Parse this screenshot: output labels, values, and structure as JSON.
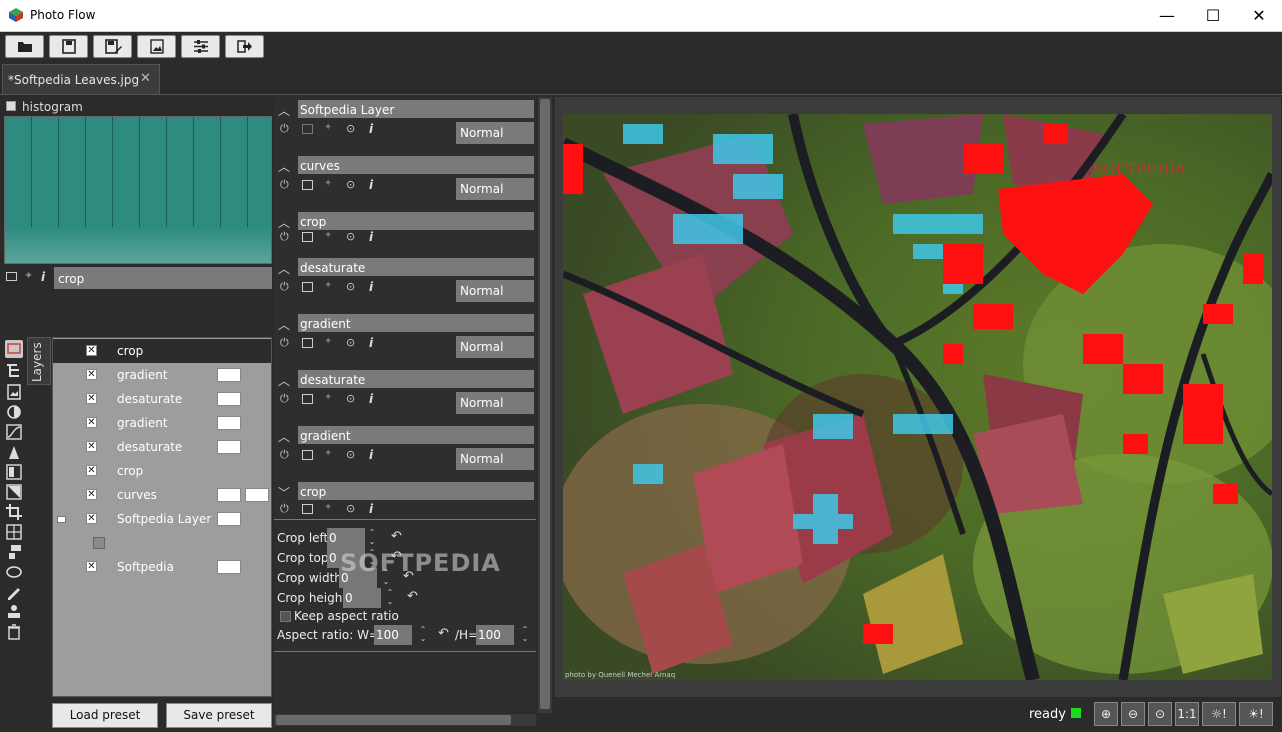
{
  "window": {
    "title": "Photo Flow",
    "minimize": "—",
    "maximize": "☐",
    "close": "✕"
  },
  "toolbar": {
    "buttons": [
      "open-file",
      "save",
      "save-as",
      "export",
      "settings",
      "exit"
    ]
  },
  "tab": {
    "label": "*Softpedia Leaves.jpg",
    "close": "✕"
  },
  "histogram": {
    "title": "histogram",
    "selected_layer": "crop"
  },
  "layers_tab": "Layers",
  "layers": [
    {
      "name": "crop",
      "selected": true,
      "swatches": 0
    },
    {
      "name": "gradient",
      "swatches": 1
    },
    {
      "name": "desaturate",
      "swatches": 1
    },
    {
      "name": "gradient",
      "swatches": 1
    },
    {
      "name": "desaturate",
      "swatches": 1
    },
    {
      "name": "crop",
      "swatches": 0
    },
    {
      "name": "curves",
      "swatches": 2
    },
    {
      "name": "Softpedia Layer",
      "swatches": 1,
      "group": true
    },
    {
      "name": "",
      "empty": true
    },
    {
      "name": "Softpedia",
      "swatches": 1
    }
  ],
  "presets": {
    "load": "Load preset",
    "save": "Save preset"
  },
  "operations": [
    {
      "name": "Softpedia Layer",
      "blend": "Normal",
      "expanded": false
    },
    {
      "name": "curves",
      "blend": "Normal",
      "expanded": false
    },
    {
      "name": "crop",
      "blend": "",
      "expanded": false
    },
    {
      "name": "desaturate",
      "blend": "Normal",
      "expanded": false
    },
    {
      "name": "gradient",
      "blend": "Normal",
      "expanded": false
    },
    {
      "name": "desaturate",
      "blend": "Normal",
      "expanded": false
    },
    {
      "name": "gradient",
      "blend": "Normal",
      "expanded": false
    },
    {
      "name": "crop",
      "blend": "",
      "expanded": true
    }
  ],
  "crop": {
    "left_label": "Crop left",
    "left": "0",
    "top_label": "Crop top",
    "top": "0",
    "width_label": "Crop width",
    "width": "0",
    "height_label": "Crop height",
    "height": "0",
    "keep_aspect": "Keep aspect ratio",
    "aspect_label": "Aspect ratio: W=",
    "aspect_w": "100",
    "h_label": "/H=",
    "aspect_h": "100"
  },
  "watermark": "SOFTPEDIA",
  "image": {
    "overlay_text": "SOFTPEDIA",
    "credit": "photo by Quenell Mechel Arnaq"
  },
  "status": {
    "text": "ready",
    "indicator_color": "#1bdc1b",
    "one_to_one": "1:1"
  }
}
